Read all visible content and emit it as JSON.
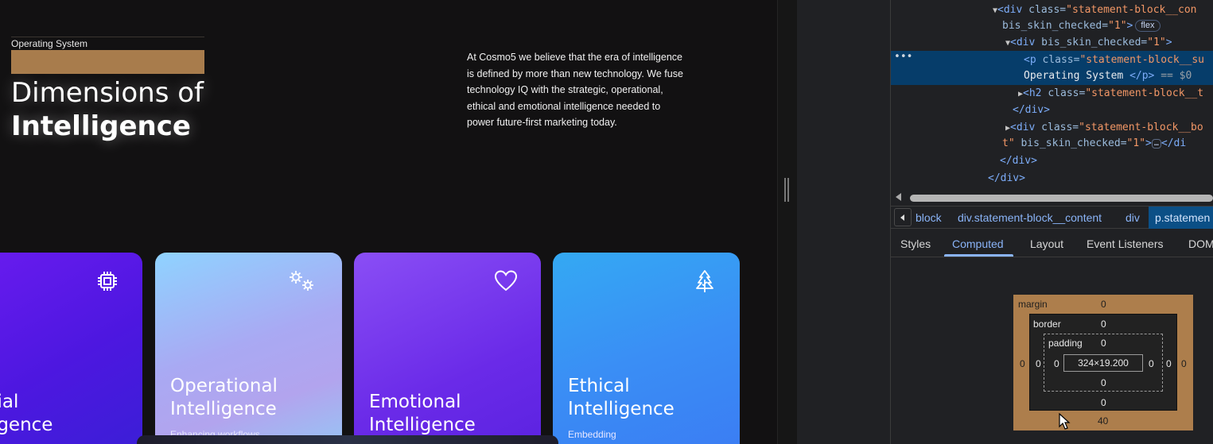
{
  "page": {
    "eyebrow": "Operating System",
    "title_line1": "Dimensions of",
    "title_line2": "Intelligence",
    "intro": "At Cosmo5 we believe that the era of intelligence is defined by more than new technology. We fuse technology IQ with the strategic, operational, ethical and emotional intelligence needed to power future-first marketing today.",
    "cards": [
      {
        "title1": "ificial",
        "title2": "elligence",
        "subtitle": "",
        "icon": "chip-icon"
      },
      {
        "title1": "Operational",
        "title2": "Intelligence",
        "subtitle": "Enhancing workflows",
        "icon": "gears-icon"
      },
      {
        "title1": "Emotional",
        "title2": "Intelligence",
        "subtitle": "",
        "icon": "heart-icon"
      },
      {
        "title1": "Ethical",
        "title2": "Intelligence",
        "subtitle": "Embedding",
        "icon": "tree-icon"
      }
    ]
  },
  "devtools": {
    "dom": {
      "l1_tag": "<div ",
      "l1_attr": "class=",
      "l1_val": "\"statement-block__con",
      "l2_attr": "bis_skin_checked=",
      "l2_val": "\"1\"",
      "l2_close": ">",
      "l2_pill": "flex",
      "l3_tag": "<div ",
      "l3_attr": "bis_skin_checked=",
      "l3_val": "\"1\"",
      "l3_close": ">",
      "l4_tag": "<p ",
      "l4_attr": "class=",
      "l4_val": "\"statement-block__su",
      "l5_text": "Operating System ",
      "l5_close": "</p>",
      "l5_eq": " == $0",
      "l6_tag": "<h2 ",
      "l6_attr": "class=",
      "l6_val": "\"statement-block__t",
      "l7_close": "</div>",
      "l8_tag": "<div ",
      "l8_attr": "class=",
      "l8_val": "\"statement-block__bo",
      "l9_val": "t\"",
      "l9_attr": " bis_skin_checked=",
      "l9_val2": "\"1\"",
      "l9_close": ">",
      "l9_ell": "…",
      "l9_end": "</di",
      "l10_close": "</div>",
      "l11_close": "</div>",
      "dots": "•••"
    },
    "crumbs": [
      "block",
      "div.statement-block__content",
      "div",
      "p.statemen"
    ],
    "tabs": [
      "Styles",
      "Computed",
      "Layout",
      "Event Listeners",
      "DOM"
    ],
    "active_tab": "Computed",
    "box_model": {
      "margin_label": "margin",
      "margin_top": "0",
      "margin_bottom": "40",
      "margin_left": "0",
      "margin_right": "0",
      "border_label": "border",
      "border_top": "0",
      "border_bottom": "0",
      "border_left": "0",
      "border_right": "0",
      "padding_label": "padding",
      "padding_top": "0",
      "padding_bottom": "0",
      "padding_left": "0",
      "padding_right": "0",
      "content": "324×19.200"
    }
  }
}
